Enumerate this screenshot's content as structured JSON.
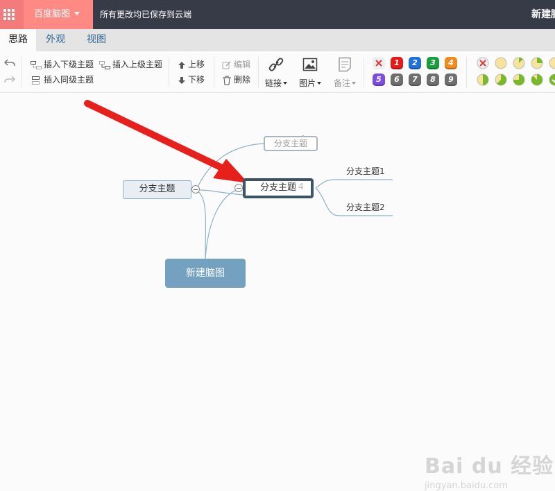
{
  "topbar": {
    "brand": "百度脑图",
    "save_status": "所有更改均已保存到云端",
    "doc_title": "新建脑图"
  },
  "tabs": [
    {
      "label": "思路",
      "active": true
    },
    {
      "label": "外观",
      "active": false
    },
    {
      "label": "视图",
      "active": false
    }
  ],
  "toolbar": {
    "insert_child": "插入下级主题",
    "insert_parent": "插入上级主题",
    "insert_sibling": "插入同级主题",
    "move_up": "上移",
    "move_down": "下移",
    "edit": "编辑",
    "delete": "删除",
    "link": "链接",
    "image": "图片",
    "note": "备注",
    "priorities": [
      {
        "label": "",
        "color": "#e8e8e8",
        "icon": "remove-icon"
      },
      {
        "label": "1",
        "color": "#e81919"
      },
      {
        "label": "2",
        "color": "#1e6fe0"
      },
      {
        "label": "3",
        "color": "#1a9e3b"
      },
      {
        "label": "4",
        "color": "#f08c1e"
      },
      {
        "label": "5",
        "color": "#7a4fe0"
      },
      {
        "label": "6",
        "color": "#6e6e6e"
      },
      {
        "label": "7",
        "color": "#6e6e6e"
      },
      {
        "label": "8",
        "color": "#6e6e6e"
      },
      {
        "label": "9",
        "color": "#6e6e6e"
      }
    ],
    "progress_levels": [
      0,
      0,
      0.125,
      0.25,
      0.375,
      0.5,
      0.625,
      0.75,
      0.875,
      1
    ]
  },
  "mindmap": {
    "root": "新建脑图",
    "main_topic": "分支主题",
    "selected_topic": "分支主题",
    "ghost_topic": "分支主题",
    "ghost_suffix": "4",
    "leaf_1": "分支主题1",
    "leaf_2": "分支主题2"
  },
  "watermark": {
    "main": "Bai du 经验",
    "sub": "jingyan.baidu.com"
  },
  "colors": {
    "topbar": "#373b48",
    "brand": "#ff8a83",
    "root_node": "#73a1bf",
    "arrow": "#e8201c"
  }
}
